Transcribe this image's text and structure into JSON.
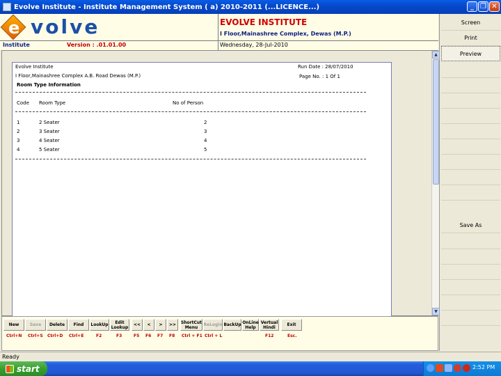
{
  "window": {
    "title": "Evolve Institute - Institute Management System ( a) 2010-2011 (...LICENCE...)"
  },
  "header": {
    "logo_e": "e",
    "logo_text": "volve",
    "org_name": "EVOLVE INSTITUTE",
    "org_address": "I Floor,Mainashree Complex, Dewas (M.P.)",
    "module": "Institute",
    "version": "Version : .01.01.00",
    "date": "Wednesday, 28-Jul-2010"
  },
  "right_panel": {
    "screen": "Screen",
    "print": "Print",
    "preview": "Preview",
    "save_as": "Save As"
  },
  "report": {
    "company": "Evolve Institute",
    "address": "I Floor,Mainashree Complex A.B. Road Dewas (M.P.)",
    "title": "Room Type Information",
    "run_date": "Run Date : 28/07/2010",
    "page_no": "Page No. : 1 Of 1",
    "columns": {
      "code": "Code",
      "room_type": "Room Type",
      "persons": "No of Person"
    },
    "rows": [
      {
        "code": "1",
        "room_type": "2 Seater",
        "persons": "2"
      },
      {
        "code": "2",
        "room_type": "3 Seater",
        "persons": "3"
      },
      {
        "code": "3",
        "room_type": "4 Seater",
        "persons": "4"
      },
      {
        "code": "4",
        "room_type": "5 Seater",
        "persons": "5"
      }
    ]
  },
  "toolbar": {
    "buttons": [
      {
        "label": "New",
        "key": "Ctrl+N",
        "enabled": true
      },
      {
        "label": "Save",
        "key": "Ctrl+S",
        "enabled": false
      },
      {
        "label": "Delete",
        "key": "Ctrl+D",
        "enabled": true
      },
      {
        "label": "Find",
        "key": "Ctrl+E",
        "enabled": true
      },
      {
        "label": "LookUp",
        "key": "F2",
        "enabled": true
      },
      {
        "label": "Edit Lookup",
        "key": "F3",
        "enabled": true
      },
      {
        "label": "<<",
        "key": "F5",
        "enabled": true
      },
      {
        "label": "<",
        "key": "F6",
        "enabled": true
      },
      {
        "label": ">",
        "key": "F7",
        "enabled": true
      },
      {
        "label": ">>",
        "key": "F8",
        "enabled": true
      },
      {
        "label": "ShortCut Menu",
        "key": "Ctrl + F1",
        "enabled": true
      },
      {
        "label": "ReLogin",
        "key": "Ctrl + L",
        "enabled": false
      },
      {
        "label": "BackUp",
        "key": "",
        "enabled": true
      },
      {
        "label": "OnLine Help",
        "key": "",
        "enabled": true
      },
      {
        "label": "Vertual Hindi",
        "key": "F12",
        "enabled": true
      },
      {
        "label": "Exit",
        "key": "Esc.",
        "enabled": true
      }
    ]
  },
  "status": {
    "text": "Ready"
  },
  "taskbar": {
    "start": "start",
    "clock": "2:52 PM"
  },
  "colors": {
    "title_blue": "#0548c9",
    "brand_red": "#d00000",
    "brand_navy": "#0d1e80",
    "header_bg": "#fffde6"
  }
}
